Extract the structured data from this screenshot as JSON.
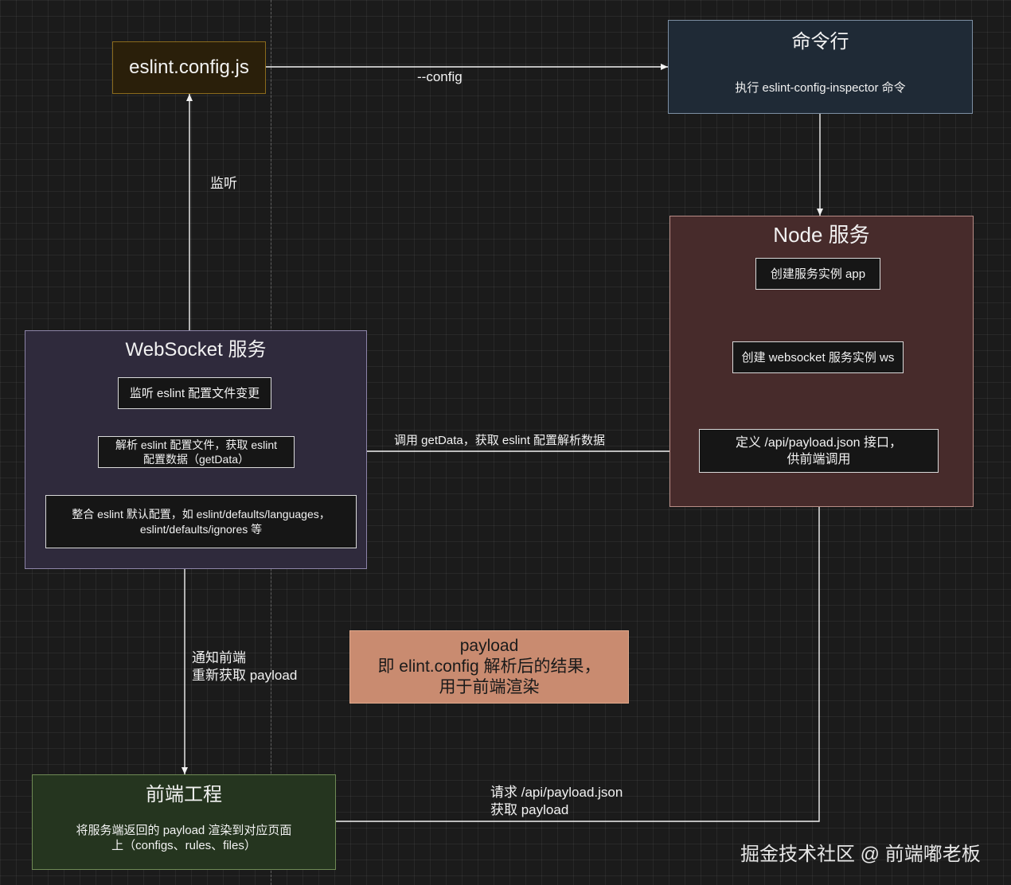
{
  "eslint_config_box": {
    "label": "eslint.config.js"
  },
  "cli_box": {
    "title": "命令行",
    "desc": "执行 eslint-config-inspector 命令"
  },
  "node_box": {
    "title": "Node 服务",
    "steps": [
      "创建服务实例 app",
      "创建 websocket 服务实例 ws"
    ],
    "api_step_line1": "定义 /api/payload.json 接口，",
    "api_step_line2": "供前端调用"
  },
  "ws_box": {
    "title": "WebSocket 服务",
    "watch_step": "监听 eslint 配置文件变更",
    "parse_step_line1": "解析 eslint 配置文件，获取 eslint",
    "parse_step_line2": "配置数据（getData）",
    "merge_step_line1": "整合 eslint 默认配置，如 eslint/defaults/languages，",
    "merge_step_line2": "eslint/defaults/ignores 等"
  },
  "frontend_box": {
    "title": "前端工程",
    "desc_line1": "将服务端返回的 payload 渲染到对应页面",
    "desc_line2": "上（configs、rules、files）"
  },
  "payload_note": {
    "line1": "payload",
    "line2": "即 elint.config 解析后的结果，",
    "line3": "用于前端渲染"
  },
  "edges": {
    "config_flag": "--config",
    "listen": "监听",
    "get_data": "调用 getData，获取 eslint 配置解析数据",
    "notify_line1": "通知前端",
    "notify_line2": "重新获取 payload",
    "request_line1": "请求 /api/payload.json",
    "request_line2": "获取 payload"
  },
  "watermark": "掘金技术社区 @ 前端嘟老板",
  "colors": {
    "background": "#1b1b1b",
    "eslint_config_fill": "#2a1f0a",
    "eslint_config_border": "#8a6a1c",
    "cli_fill": "#1f2a36",
    "cli_border": "#7d8fa3",
    "node_fill": "#472b2b",
    "node_border": "#b98d86",
    "ws_fill": "#2f2a3c",
    "ws_border": "#8d84a8",
    "frontend_fill": "#25351f",
    "frontend_border": "#6f8a55",
    "payload_fill": "#c98b70",
    "payload_border": "#e0a98c"
  }
}
